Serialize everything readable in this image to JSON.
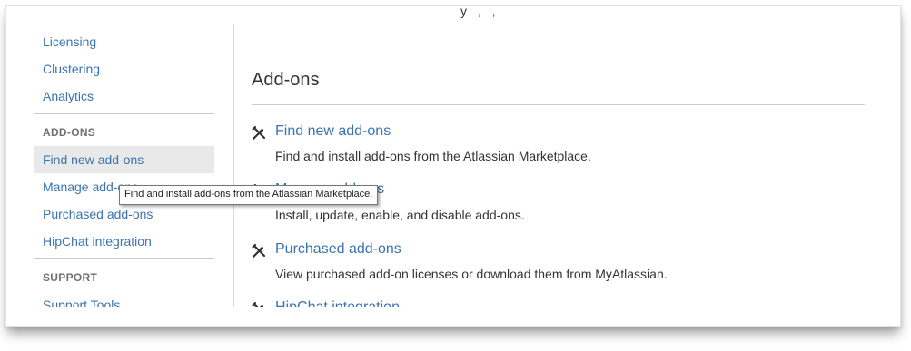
{
  "sidebar": {
    "links_top": [
      "Licensing",
      "Clustering",
      "Analytics"
    ],
    "addons_heading": "ADD-ONS",
    "addons_links": [
      "Find new add-ons",
      "Manage add-ons",
      "Purchased add-ons",
      "HipChat integration"
    ],
    "support_heading": "SUPPORT",
    "support_links": [
      "Support Tools"
    ]
  },
  "main": {
    "cut_text": "y , ,",
    "section_title": "Add-ons",
    "items": [
      {
        "title": "Find new add-ons",
        "description": "Find and install add-ons from the Atlassian Marketplace.",
        "icon": "tools-icon"
      },
      {
        "title": "Manage add-ons",
        "description": "Install, update, enable, and disable add-ons.",
        "icon": "tools-icon"
      },
      {
        "title": "Purchased add-ons",
        "description": "View purchased add-on licenses or download them from MyAtlassian.",
        "icon": "tools-icon"
      },
      {
        "title": "HipChat integration",
        "description": "",
        "icon": "tools-icon"
      }
    ]
  },
  "tooltip": {
    "text": "Find and install add-ons from the Atlassian Marketplace."
  },
  "colors": {
    "link": "#3b73af",
    "active_bg": "#e9e9e9",
    "heading": "#707070",
    "text": "#333333"
  }
}
